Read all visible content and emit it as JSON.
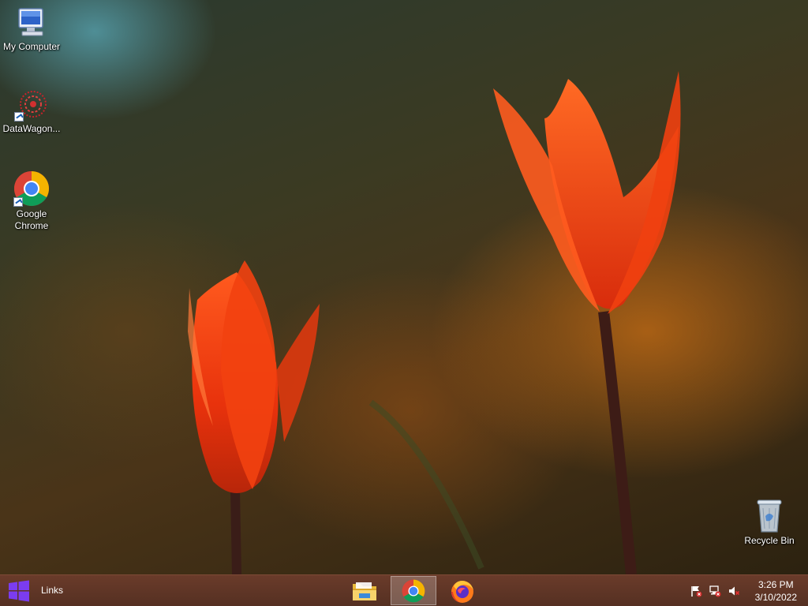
{
  "desktop": {
    "icons": [
      {
        "label": "My Computer",
        "icon": "computer-icon"
      },
      {
        "label": "DataWagon...",
        "icon": "datawagon-icon",
        "shortcut": true
      },
      {
        "label": "Google Chrome",
        "icon": "chrome-icon",
        "shortcut": true
      },
      {
        "label": "Recycle Bin",
        "icon": "recycle-bin-icon"
      }
    ]
  },
  "taskbar": {
    "start": {
      "icon": "windows-logo-icon",
      "color": "#7b3cf0"
    },
    "toolbar_label": "Links",
    "pinned_apps": [
      {
        "name": "File Explorer",
        "icon": "file-explorer-icon",
        "active": false
      },
      {
        "name": "Google Chrome",
        "icon": "chrome-icon",
        "active": true
      },
      {
        "name": "Firefox",
        "icon": "firefox-icon",
        "active": false
      }
    ],
    "tray": [
      {
        "icon": "action-center-flag-icon"
      },
      {
        "icon": "network-icon"
      },
      {
        "icon": "volume-muted-icon"
      }
    ],
    "clock": {
      "time": "3:26 PM",
      "date": "3/10/2022"
    }
  },
  "colors": {
    "taskbar": "#5e3526",
    "chrome_red": "#db4437",
    "chrome_yellow": "#f4b400",
    "chrome_green": "#0f9d58",
    "chrome_blue": "#4285f4"
  }
}
